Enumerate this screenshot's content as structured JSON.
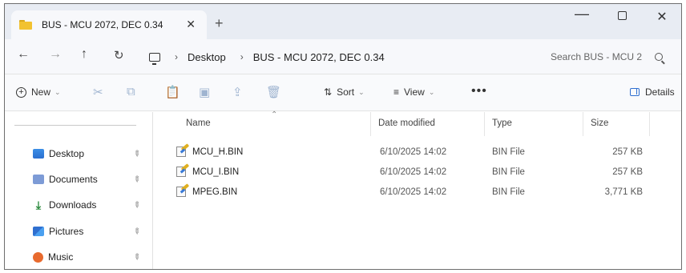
{
  "tab": {
    "title": "BUS - MCU 2072, DEC 0.34",
    "close_glyph": "✕",
    "new_glyph": "+"
  },
  "window_controls": {
    "minimize": "—",
    "close": "✕"
  },
  "nav": {
    "back": "←",
    "forward": "→",
    "up": "↑",
    "refresh": "↻"
  },
  "breadcrumb": {
    "items": [
      "Desktop",
      "BUS - MCU 2072, DEC 0.34"
    ],
    "separator": "›"
  },
  "search": {
    "placeholder": "Search BUS - MCU 2"
  },
  "commands": {
    "new_label": "New",
    "sort_label": "Sort",
    "view_label": "View",
    "more_label": "•••",
    "details_label": "Details",
    "chevron": "⌄"
  },
  "sidebar": {
    "items": [
      {
        "label": "Desktop",
        "icon": "desktop-icon"
      },
      {
        "label": "Documents",
        "icon": "documents-icon"
      },
      {
        "label": "Downloads",
        "icon": "downloads-icon"
      },
      {
        "label": "Pictures",
        "icon": "pictures-icon"
      },
      {
        "label": "Music",
        "icon": "music-icon"
      }
    ],
    "pin_glyph": "📌"
  },
  "columns": {
    "name": "Name",
    "date": "Date modified",
    "type": "Type",
    "size": "Size"
  },
  "files": [
    {
      "name": "MCU_H.BIN",
      "date": "6/10/2025 14:02",
      "type": "BIN File",
      "size": "257 KB"
    },
    {
      "name": "MCU_I.BIN",
      "date": "6/10/2025 14:02",
      "type": "BIN File",
      "size": "257 KB"
    },
    {
      "name": "MPEG.BIN",
      "date": "6/10/2025 14:02",
      "type": "BIN File",
      "size": "3,771 KB"
    }
  ],
  "colors": {
    "accent": "#2f6fd0",
    "folder": "#f2c230",
    "titlebar": "#e8ecf3"
  }
}
